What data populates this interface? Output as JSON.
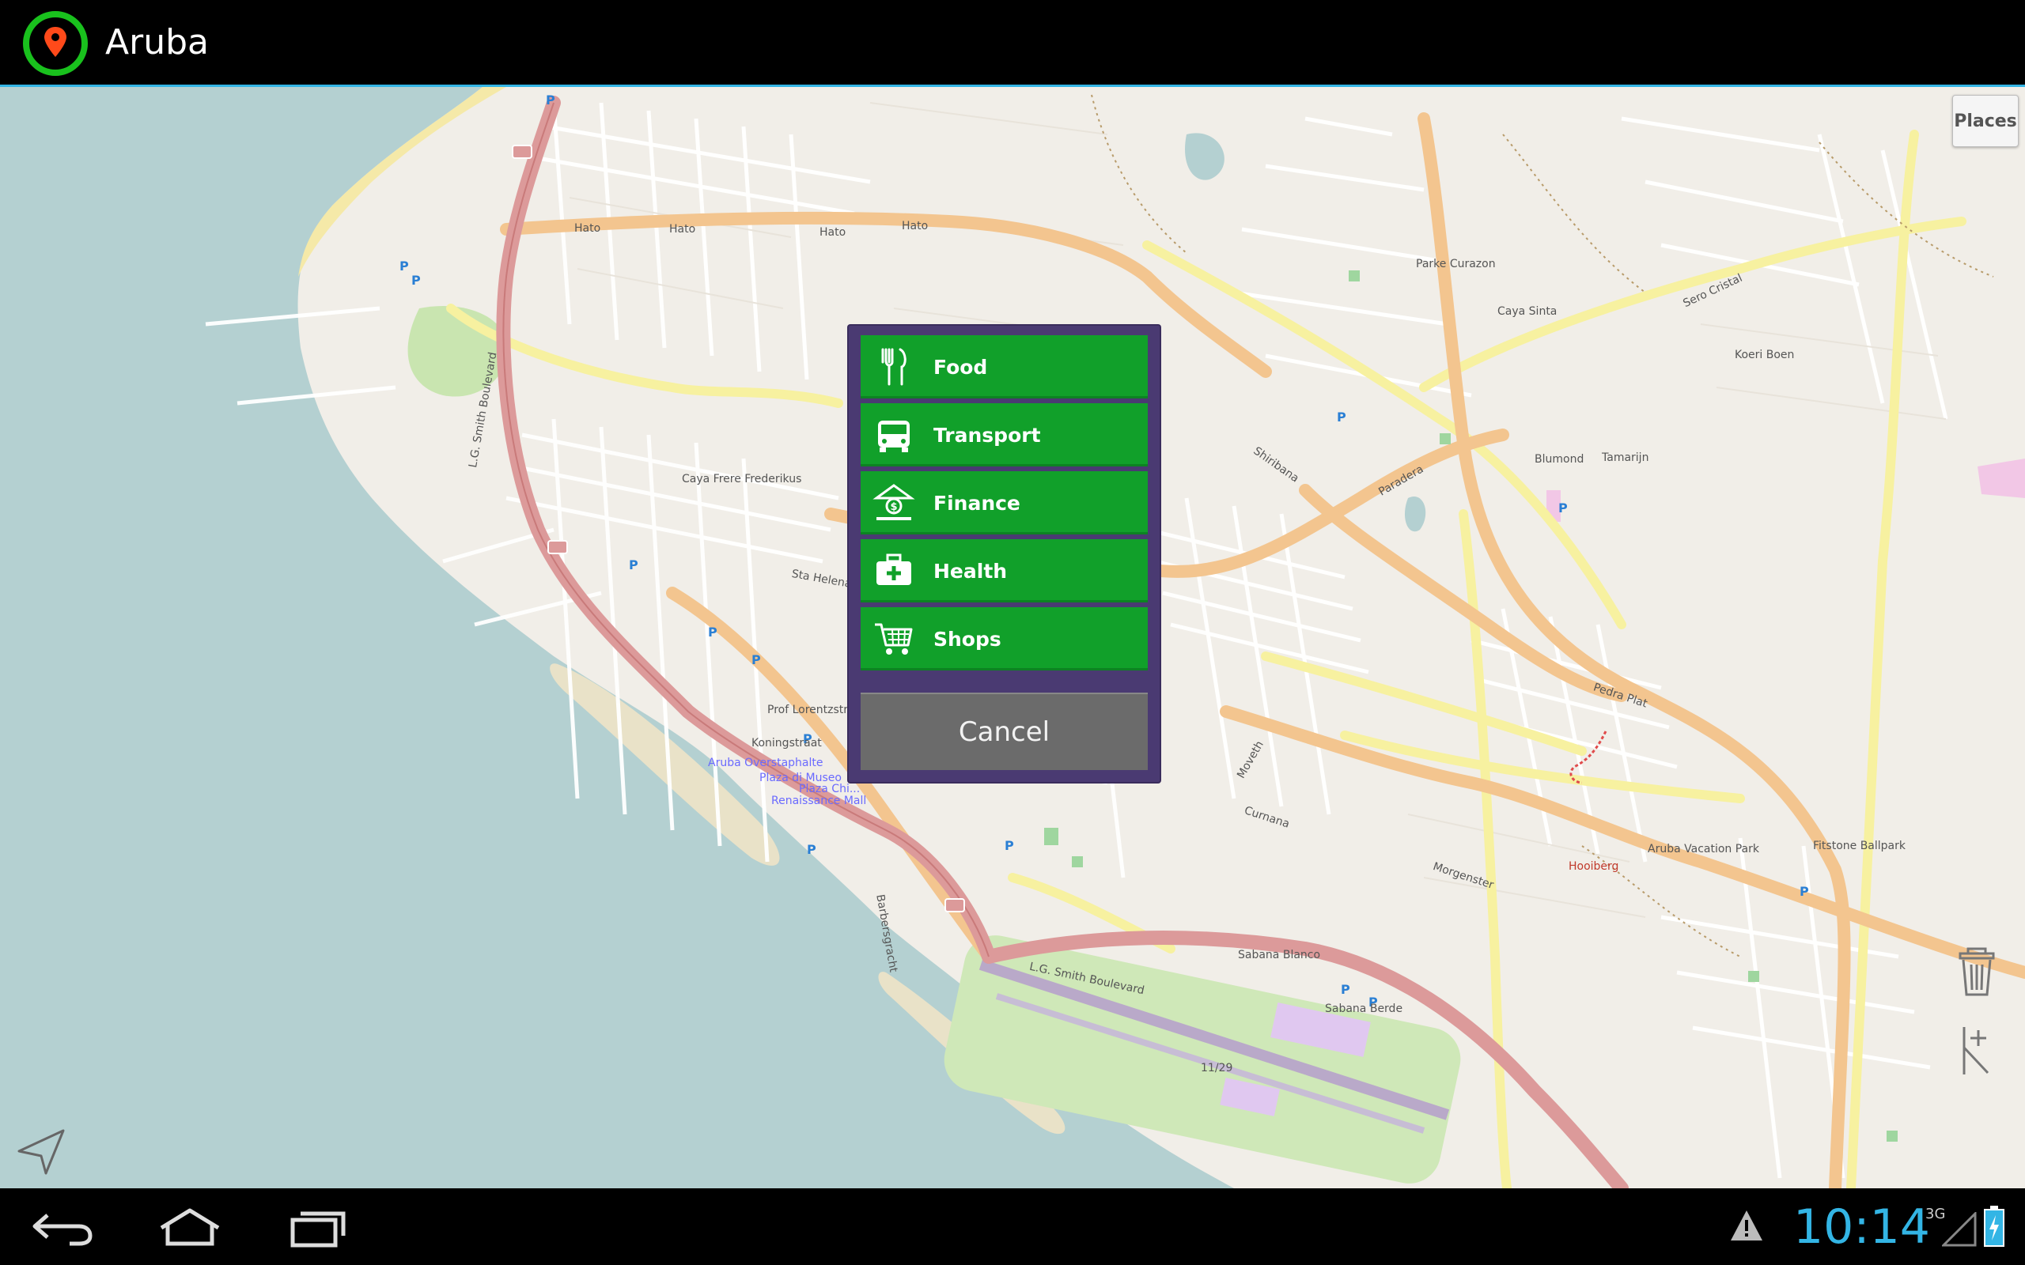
{
  "app": {
    "title": "Aruba",
    "accent": "#33b5e5",
    "logo_icon": "map-pin-icon"
  },
  "map": {
    "places_button": "Places",
    "labels": [
      {
        "text": "Hato"
      },
      {
        "text": "Hato"
      },
      {
        "text": "Hato"
      },
      {
        "text": "Hato"
      },
      {
        "text": "L.G. Smith Boulevard"
      },
      {
        "text": "L.G. Smith Boulevard"
      },
      {
        "text": "Sta Helenastraat"
      },
      {
        "text": "Prof Lorentzstraat"
      },
      {
        "text": "Koningstraat"
      },
      {
        "text": "Caya Frere Frederikus"
      },
      {
        "text": "Parke Curazon"
      },
      {
        "text": "Caya Sinta"
      },
      {
        "text": "Sero Cristal"
      },
      {
        "text": "Koeri Boen"
      },
      {
        "text": "Paradera"
      },
      {
        "text": "Shiribana"
      },
      {
        "text": "Blumond"
      },
      {
        "text": "Tamarijn"
      },
      {
        "text": "Pedra Plat"
      },
      {
        "text": "Curnana"
      },
      {
        "text": "Morgenster"
      },
      {
        "text": "Hooiberg"
      },
      {
        "text": "Aruba Vacation Park"
      },
      {
        "text": "Fitstone Ballpark"
      },
      {
        "text": "Aruba Overstaphalte"
      },
      {
        "text": "Plaza di Museo"
      },
      {
        "text": "Renaissance Mall"
      },
      {
        "text": "Plaza Chi..."
      },
      {
        "text": "Barbersgracht"
      },
      {
        "text": "Moveth"
      },
      {
        "text": "Sabana Blanco"
      },
      {
        "text": "Sabana Berde"
      },
      {
        "text": "11/29"
      }
    ]
  },
  "dialog": {
    "items": [
      {
        "label": "Food",
        "icon": "fork-knife-icon"
      },
      {
        "label": "Transport",
        "icon": "bus-icon"
      },
      {
        "label": "Finance",
        "icon": "bank-icon"
      },
      {
        "label": "Health",
        "icon": "first-aid-kit-icon"
      },
      {
        "label": "Shops",
        "icon": "shopping-cart-icon"
      }
    ],
    "cancel_label": "Cancel",
    "item_color": "#11a02a",
    "frame_color": "#4a3a72"
  },
  "controls": {
    "locate_icon": "navigation-arrow-icon",
    "trash_icon": "trash-icon",
    "add_marker_icon": "add-marker-icon"
  },
  "statusbar": {
    "time": "10:14",
    "network": "3G",
    "warning_icon": "warning-icon",
    "signal_icon": "signal-icon",
    "battery_icon": "battery-charging-icon"
  },
  "navbar": {
    "back_icon": "back-icon",
    "home_icon": "home-icon",
    "recents_icon": "recents-icon"
  }
}
